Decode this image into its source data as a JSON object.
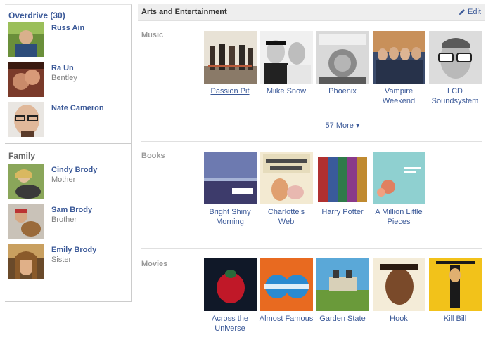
{
  "left": {
    "groups": [
      {
        "title": "Overdrive (30)",
        "people": [
          {
            "name": "Russ Ain",
            "sub": ""
          },
          {
            "name": "Ra Un",
            "sub": "Bentley"
          },
          {
            "name": "Nate Cameron",
            "sub": ""
          }
        ]
      },
      {
        "title": "Family",
        "people": [
          {
            "name": "Cindy Brody",
            "sub": "Mother"
          },
          {
            "name": "Sam Brody",
            "sub": "Brother"
          },
          {
            "name": "Emily Brody",
            "sub": "Sister"
          }
        ]
      }
    ]
  },
  "header": {
    "title": "Arts and Entertainment",
    "edit_label": "Edit"
  },
  "music": {
    "label": "Music",
    "items": [
      {
        "title": "Passion Pit"
      },
      {
        "title": "Miike Snow"
      },
      {
        "title": "Phoenix"
      },
      {
        "title": "Vampire\nWeekend"
      },
      {
        "title": "LCD\nSoundsystem"
      }
    ],
    "more_label": "57 More ▾"
  },
  "books": {
    "label": "Books",
    "items": [
      {
        "title": "Bright Shiny\nMorning"
      },
      {
        "title": "Charlotte's\nWeb"
      },
      {
        "title": "Harry Potter"
      },
      {
        "title": "A Million Little\nPieces"
      }
    ]
  },
  "movies": {
    "label": "Movies",
    "items": [
      {
        "title": "Across the\nUniverse"
      },
      {
        "title": "Almost Famous"
      },
      {
        "title": "Garden State"
      },
      {
        "title": "Hook"
      },
      {
        "title": "Kill Bill"
      }
    ]
  },
  "colors": {
    "link": "#3b5998",
    "label_gray": "#999999",
    "header_bg": "#eeeeee"
  }
}
